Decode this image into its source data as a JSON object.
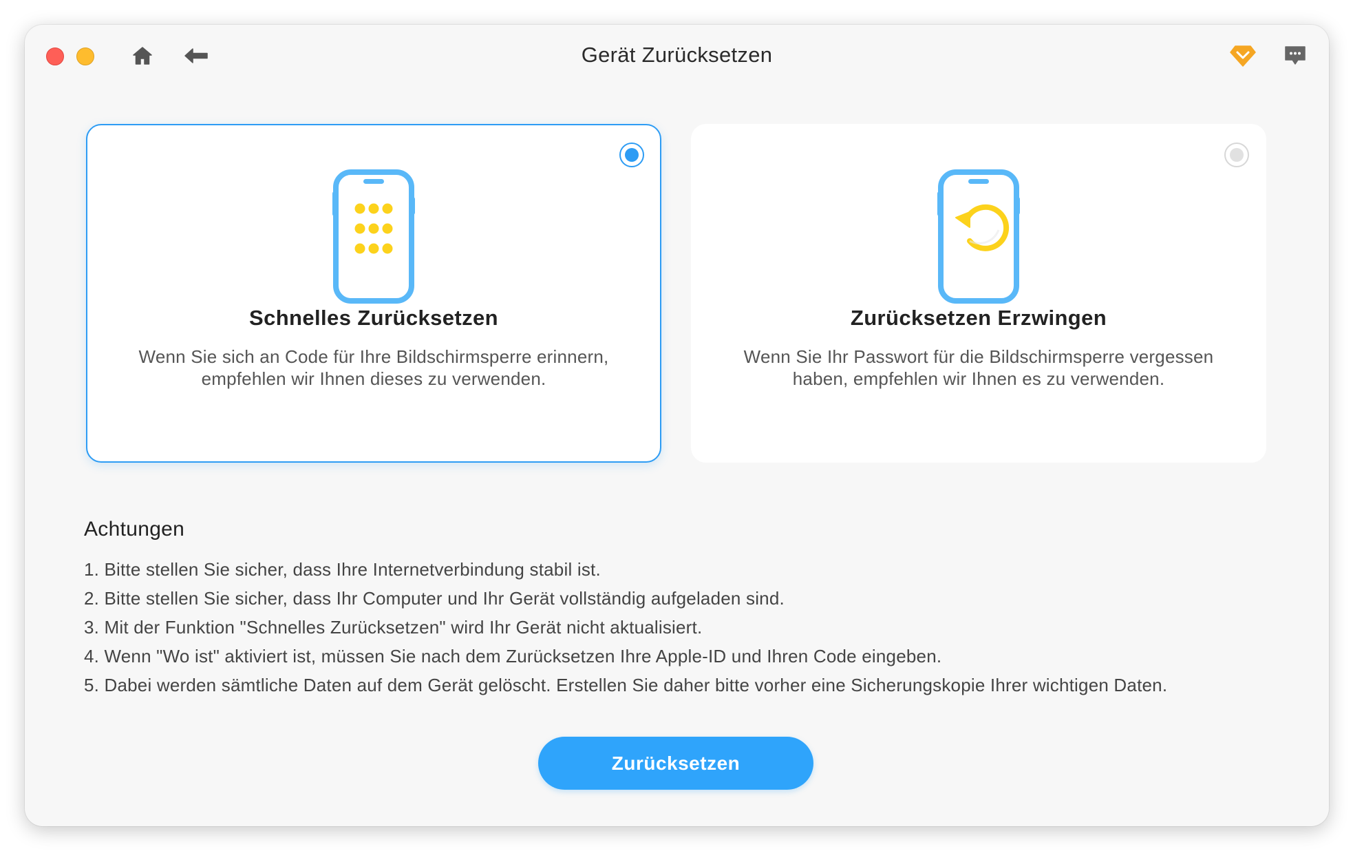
{
  "window": {
    "title": "Gerät Zurücksetzen"
  },
  "toolbar": {
    "icons": [
      "close-icon",
      "minimize-icon",
      "home-icon",
      "back-arrow-icon",
      "premium-diamond-icon",
      "feedback-icon"
    ],
    "accent_premium": "#f5a623"
  },
  "options": [
    {
      "title": "Schnelles Zurücksetzen",
      "description": "Wenn Sie sich an Code für Ihre Bildschirmsperre erinnern, empfehlen wir Ihnen dieses zu verwenden.",
      "selected": true,
      "icon": "phone-keypad-icon"
    },
    {
      "title": "Zurücksetzen Erzwingen",
      "description": "Wenn Sie Ihr Passwort für die Bildschirmsperre vergessen haben, empfehlen wir Ihnen es zu verwenden.",
      "selected": false,
      "icon": "phone-reset-icon"
    }
  ],
  "notes": {
    "title": "Achtungen",
    "items": [
      "1. Bitte stellen Sie sicher, dass Ihre Internetverbindung stabil ist.",
      "2. Bitte stellen Sie sicher, dass Ihr Computer und Ihr Gerät vollständig aufgeladen sind.",
      "3. Mit der Funktion \"Schnelles Zurücksetzen\" wird Ihr Gerät nicht aktualisiert.",
      "4. Wenn \"Wo ist\" aktiviert ist, müssen Sie nach dem Zurücksetzen Ihre Apple-ID und Ihren Code eingeben.",
      "5. Dabei werden sämtliche Daten auf dem Gerät gelöscht. Erstellen Sie daher bitte vorher eine Sicherungskopie Ihrer wichtigen Daten."
    ]
  },
  "actions": {
    "reset_label": "Zurücksetzen"
  },
  "colors": {
    "accent": "#2d9cf4",
    "button": "#2fa4fb",
    "phone_outline": "#59b8f8",
    "icon_yellow": "#fcd21c"
  }
}
